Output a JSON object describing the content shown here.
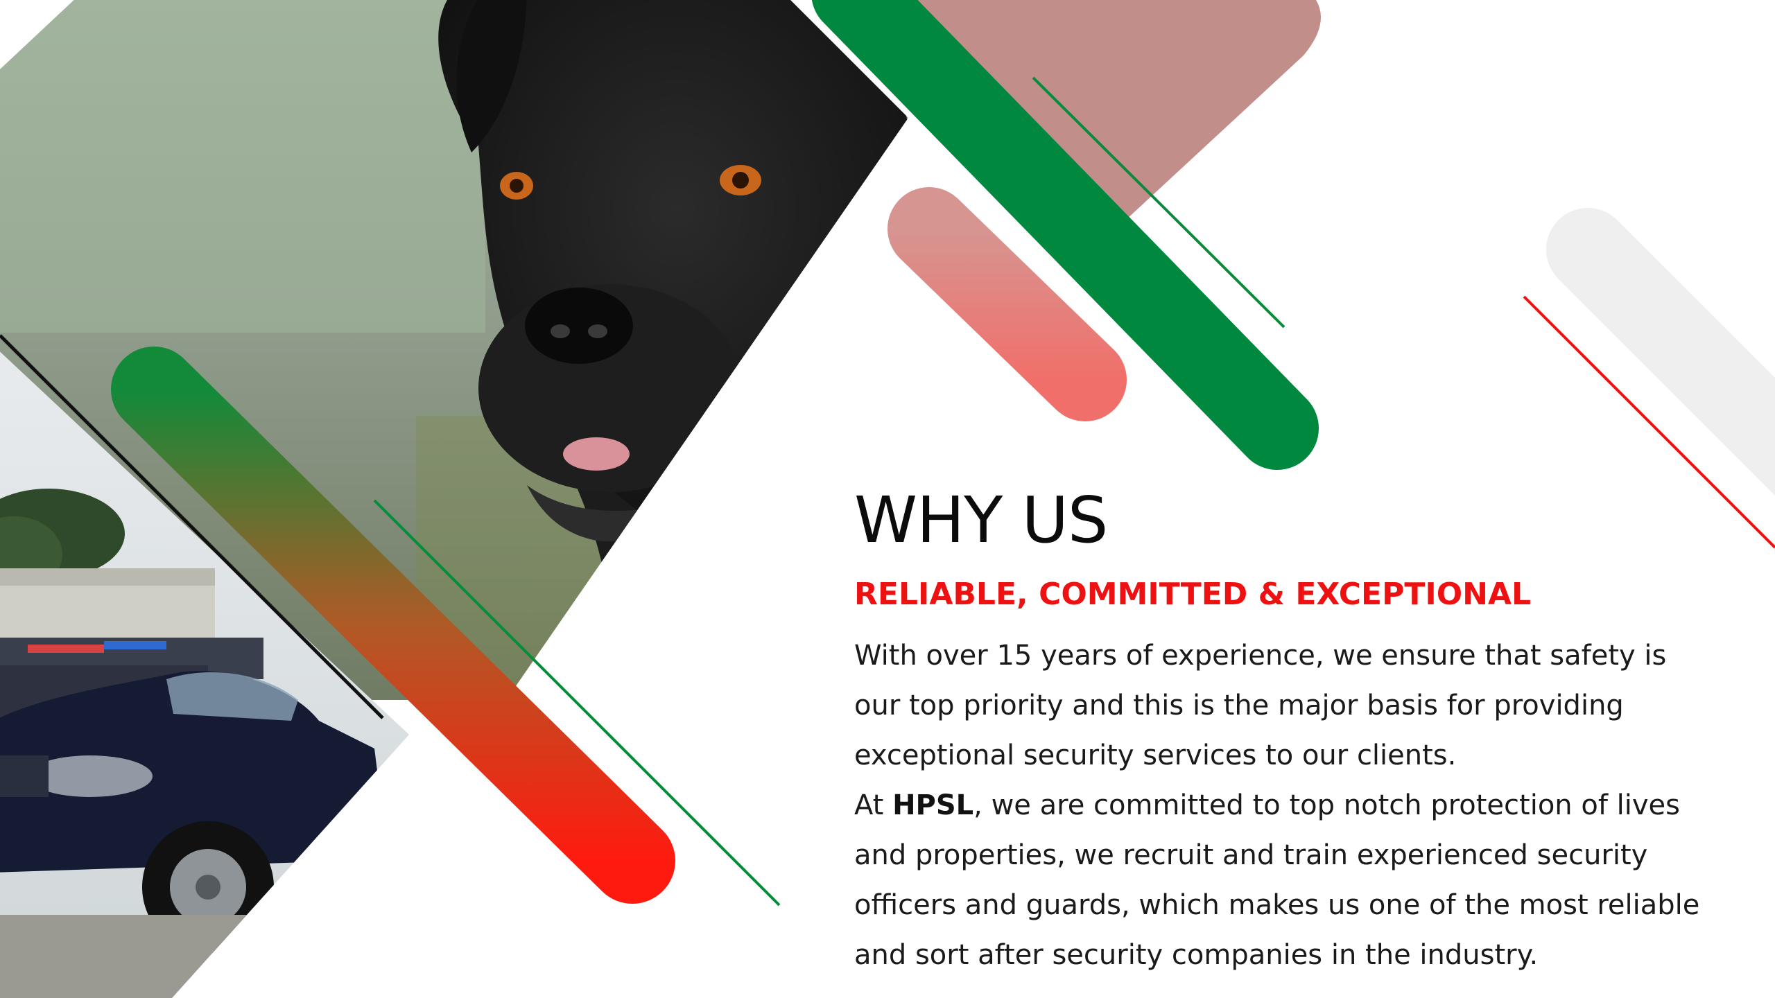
{
  "section": {
    "title": "WHY US",
    "tagline": "RELIABLE, COMMITTED & EXCEPTIONAL",
    "paragraph_1": "With over 15 years of experience, we ensure that safety is our top priority and this is the major basis for providing exceptional security services to our clients.",
    "paragraph_2_prefix": "At ",
    "company_abbrev": "HPSL",
    "paragraph_2_rest": ", we are committed to top notch protection of lives and properties, we recruit and train experienced security officers and guards, which makes us one of the most reliable and sort after security companies in the industry."
  },
  "images": {
    "main_photo": "guard-dog-photo",
    "secondary_photo": "patrol-vehicles-photo"
  },
  "colors": {
    "brand_green": "#00883e",
    "brand_red": "#ee1111",
    "text_dark": "#1a1a1a",
    "light_grey": "#efefef",
    "navy_vehicle": "#141b33"
  }
}
